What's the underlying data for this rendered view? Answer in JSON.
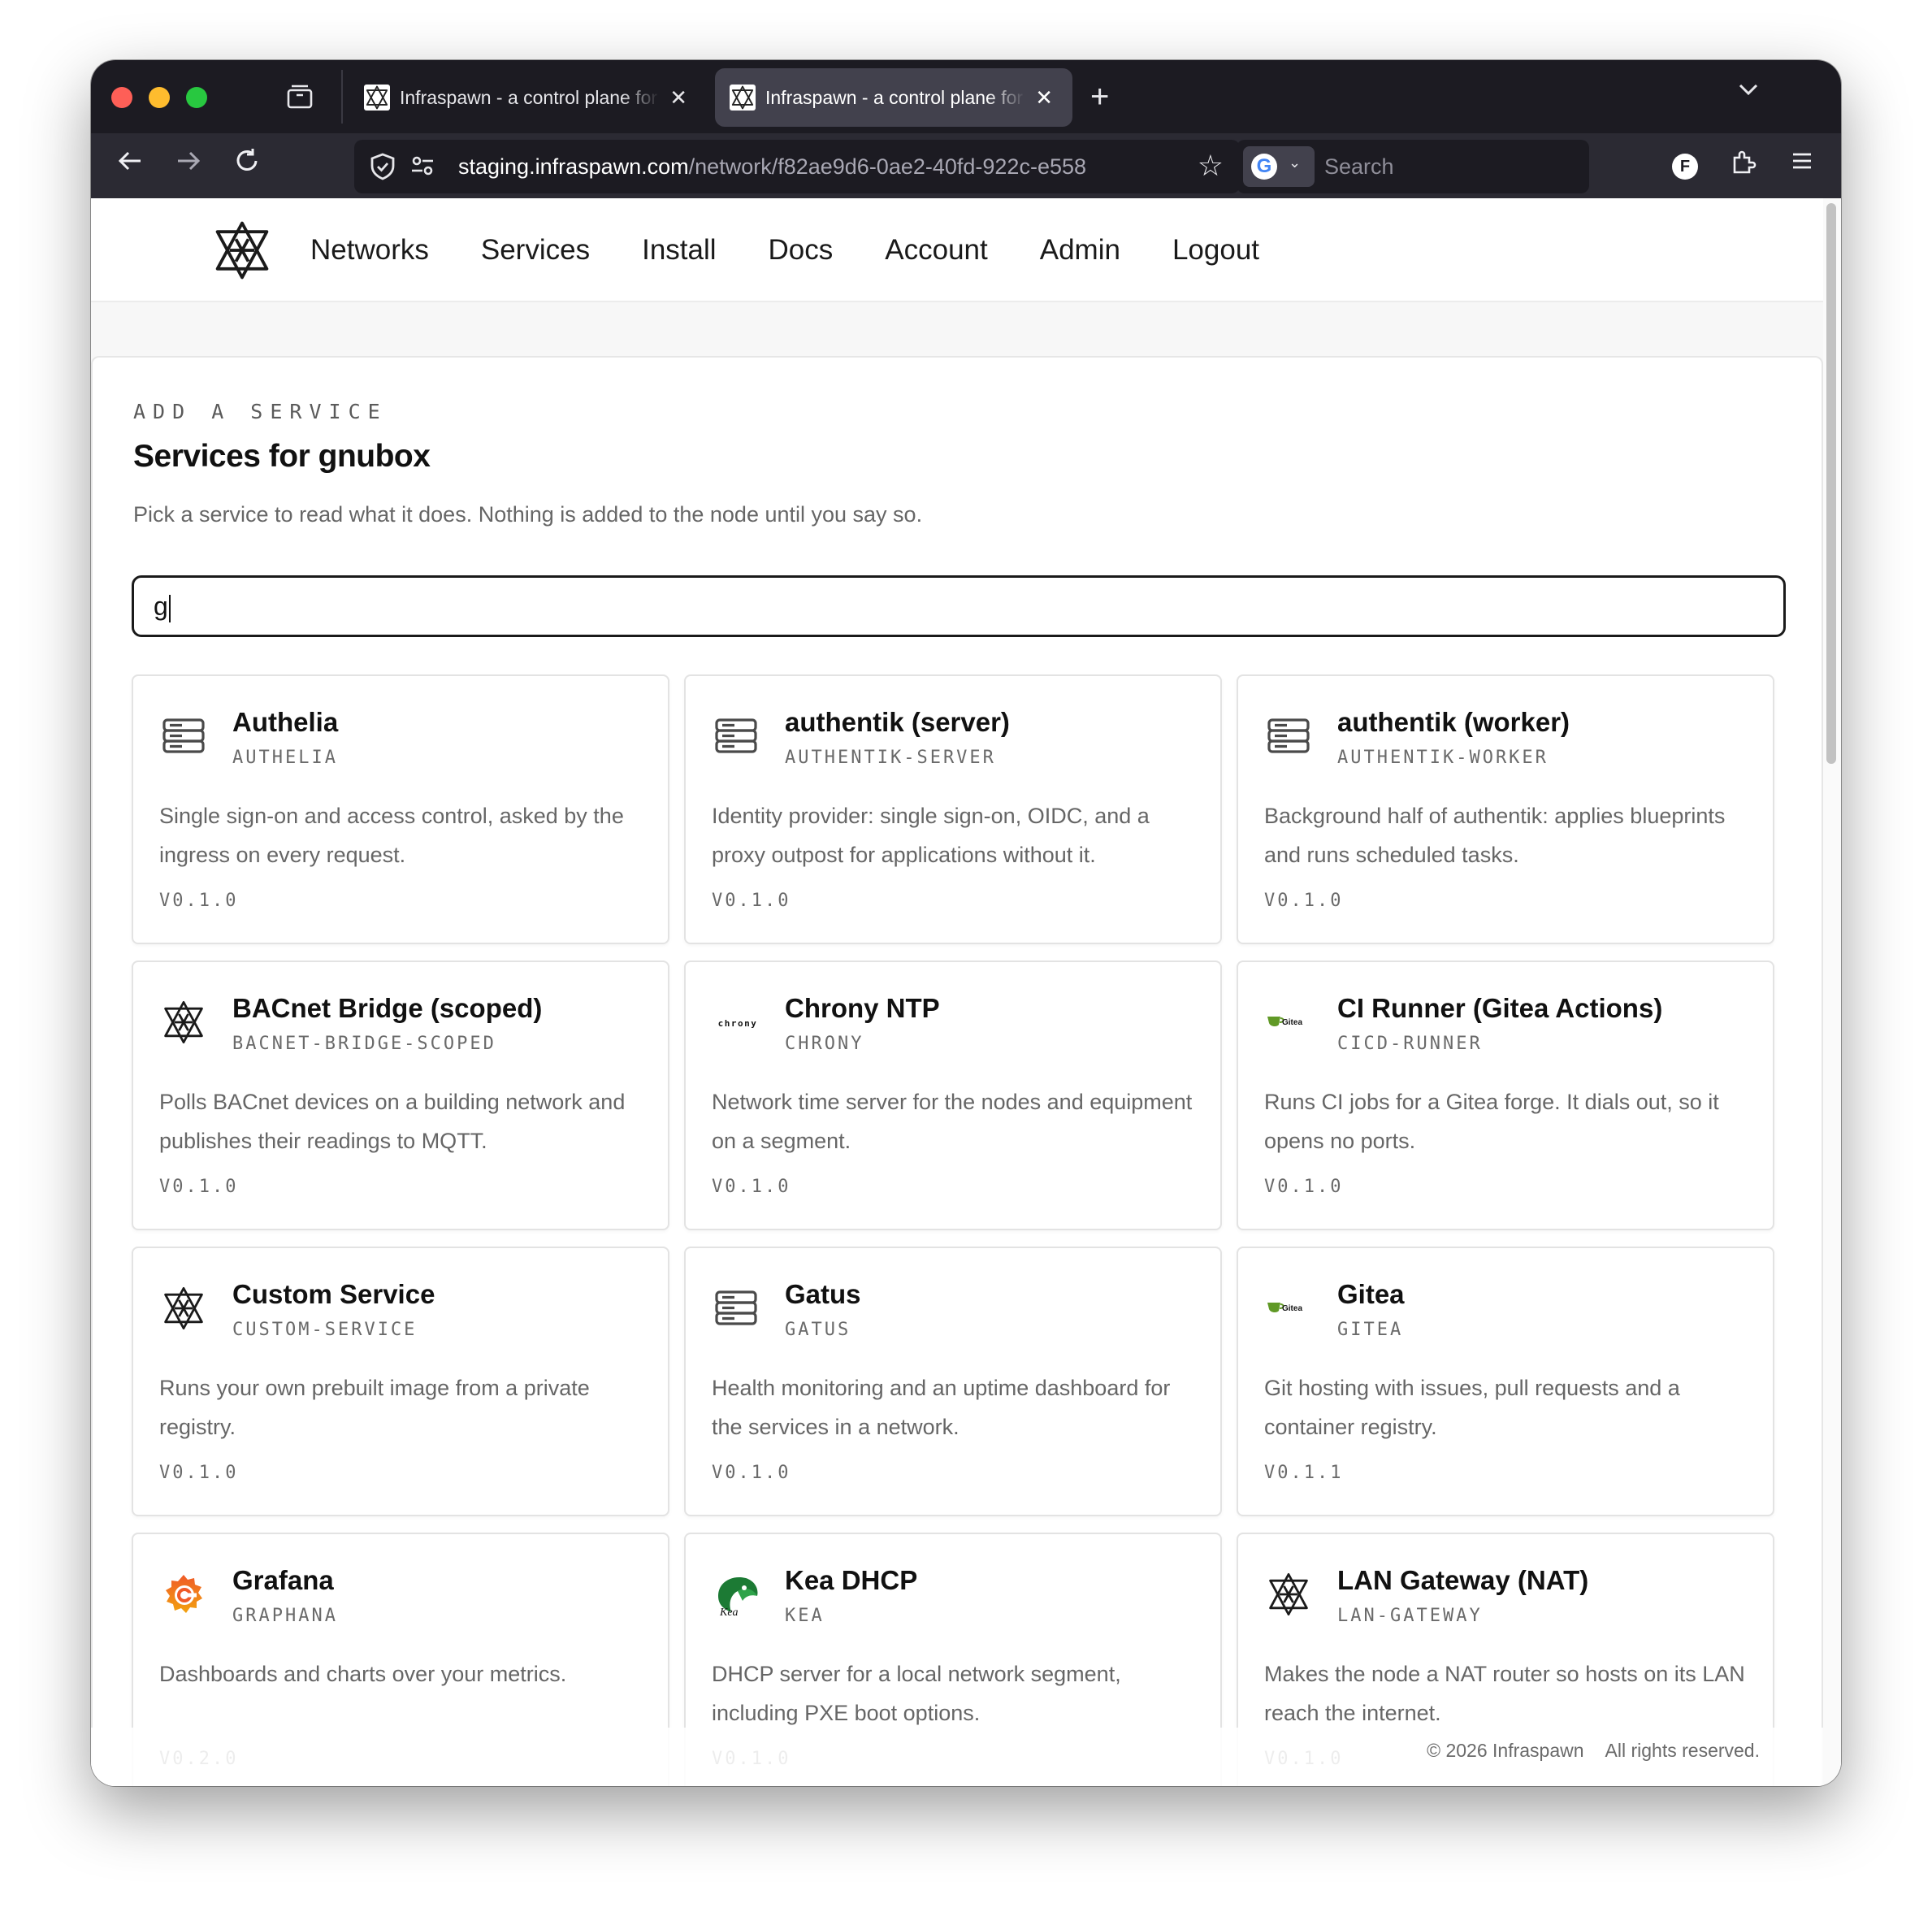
{
  "browser": {
    "tabs": [
      {
        "title": "Infraspawn - a control plane for",
        "active": false
      },
      {
        "title": "Infraspawn - a control plane for",
        "active": true
      }
    ],
    "url_host": "staging.infraspawn.com",
    "url_path": "/network/f82ae9d6-0ae2-40fd-922c-e558",
    "search_placeholder": "Search",
    "engine_letter": "G",
    "account_letter": "F"
  },
  "site": {
    "nav": [
      "Networks",
      "Services",
      "Install",
      "Docs",
      "Account",
      "Admin",
      "Logout"
    ]
  },
  "panel": {
    "eyebrow": "ADD A SERVICE",
    "title": "Services for gnubox",
    "subtitle": "Pick a service to read what it does. Nothing is added to the node until you say so.",
    "search_value": "g"
  },
  "services": [
    {
      "name": "Authelia",
      "slug": "AUTHELIA",
      "desc": "Single sign-on and access control, asked by the ingress on every request.",
      "version": "V0.1.0",
      "icon": "server-icon"
    },
    {
      "name": "authentik (server)",
      "slug": "AUTHENTIK-SERVER",
      "desc": "Identity provider: single sign-on, OIDC, and a proxy outpost for applications without it.",
      "version": "V0.1.0",
      "icon": "server-icon"
    },
    {
      "name": "authentik (worker)",
      "slug": "AUTHENTIK-WORKER",
      "desc": "Background half of authentik: applies blueprints and runs scheduled tasks.",
      "version": "V0.1.0",
      "icon": "server-icon"
    },
    {
      "name": "BACnet Bridge (scoped)",
      "slug": "BACNET-BRIDGE-SCOPED",
      "desc": "Polls BACnet devices on a building network and publishes their readings to MQTT.",
      "version": "V0.1.0",
      "icon": "infraspawn-star-icon"
    },
    {
      "name": "Chrony NTP",
      "slug": "CHRONY",
      "desc": "Network time server for the nodes and equipment on a segment.",
      "version": "V0.1.0",
      "icon": "chrony-logo-icon",
      "icon_text": "chrony"
    },
    {
      "name": "CI Runner (Gitea Actions)",
      "slug": "CICD-RUNNER",
      "desc": "Runs CI jobs for a Gitea forge. It dials out, so it opens no ports.",
      "version": "V0.1.0",
      "icon": "gitea-logo-icon",
      "icon_text": "Gitea"
    },
    {
      "name": "Custom Service",
      "slug": "CUSTOM-SERVICE",
      "desc": "Runs your own prebuilt image from a private registry.",
      "version": "V0.1.0",
      "icon": "infraspawn-star-icon"
    },
    {
      "name": "Gatus",
      "slug": "GATUS",
      "desc": "Health monitoring and an uptime dashboard for the services in a network.",
      "version": "V0.1.0",
      "icon": "server-icon"
    },
    {
      "name": "Gitea",
      "slug": "GITEA",
      "desc": "Git hosting with issues, pull requests and a container registry.",
      "version": "V0.1.1",
      "icon": "gitea-logo-icon",
      "icon_text": "Gitea"
    },
    {
      "name": "Grafana",
      "slug": "GRAPHANA",
      "desc": "Dashboards and charts over your metrics.",
      "version": "V0.2.0",
      "icon": "grafana-logo-icon"
    },
    {
      "name": "Kea DHCP",
      "slug": "KEA",
      "desc": "DHCP server for a local network segment, including PXE boot options.",
      "version": "V0.1.0",
      "icon": "kea-logo-icon",
      "icon_text": "Kea"
    },
    {
      "name": "LAN Gateway (NAT)",
      "slug": "LAN-GATEWAY",
      "desc": "Makes the node a NAT router so hosts on its LAN reach the internet.",
      "version": "V0.1.0",
      "icon": "infraspawn-star-icon"
    }
  ],
  "footer": {
    "copyright": "© 2026 Infraspawn",
    "rights": "All rights reserved."
  }
}
